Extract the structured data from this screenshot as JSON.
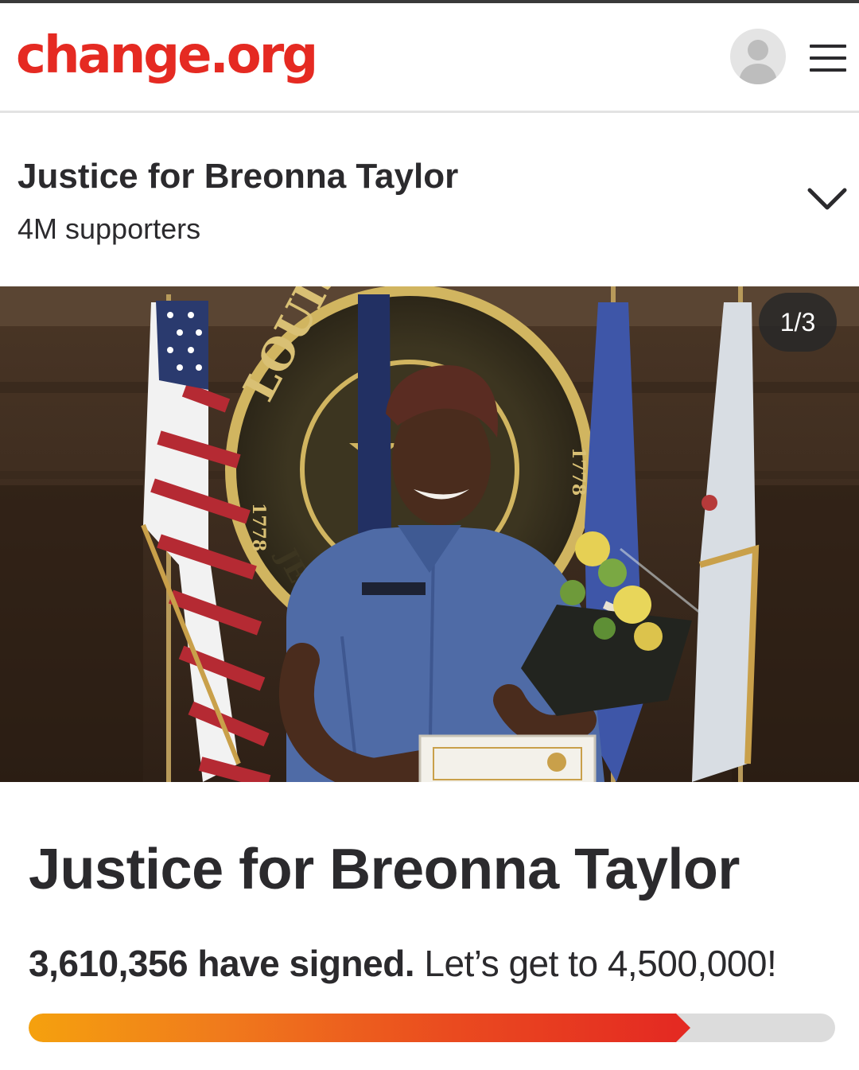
{
  "header": {
    "logo": "change.org",
    "avatar_icon": "user-avatar-icon",
    "menu_icon": "hamburger-menu-icon"
  },
  "petition_bar": {
    "title": "Justice for Breonna Taylor",
    "supporters": "4M supporters",
    "toggle_icon": "chevron-down-icon"
  },
  "hero": {
    "counter": "1/3",
    "seal_text": "LOUISVILLE",
    "seal_year": "1778",
    "seal_partial": "JE"
  },
  "petition": {
    "title": "Justice for Breonna Taylor",
    "signed_text": "3,610,356 have signed.",
    "goal_text": "Let’s get to 4,500,000!",
    "signed_count": 3610356,
    "goal_count": 4500000,
    "progress_fraction": 0.8023
  },
  "colors": {
    "brand": "#e52a22",
    "text": "#2b2a2d",
    "progress_start": "#f5a10e",
    "progress_end": "#e42a22",
    "progress_track": "#dcdcdc"
  }
}
